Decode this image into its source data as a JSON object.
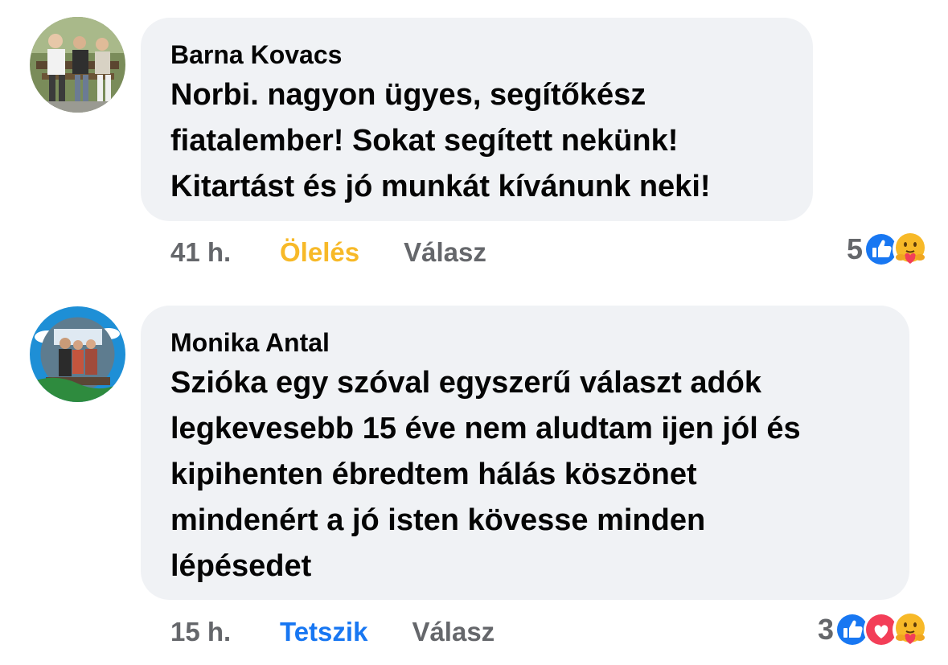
{
  "comments": [
    {
      "author": "Barna Kovacs",
      "text": "Norbi. nagyon ügyes, segítőkész fiatalember! Sokat segített nekünk! Kitartást és jó munkát kívánunk neki!",
      "lines": [
        "Norbi. nagyon ügyes, segítőkész",
        "fiatalember! Sokat segített nekünk!",
        "Kitartást és jó munkát kívánunk neki!"
      ],
      "time": "41 h.",
      "reaction_label": "Ölelés",
      "reaction_label_color": "#f7b928",
      "reply_label": "Válasz",
      "reaction_count": "5",
      "reaction_icons": [
        "like-icon",
        "care-icon"
      ]
    },
    {
      "author": "Monika Antal",
      "text": "Szióka egy szóval egyszerű választ adók legkevesebb 15 éve nem aludtam ijen jól és kipihenten ébredtem hálás köszönet mindenért a jó isten kövesse minden lépésedet",
      "lines": [
        "Szióka egy szóval egyszerű választ adók",
        "legkevesebb 15 éve nem aludtam ijen jól és",
        "kipihenten ébredtem hálás köszönet",
        "mindenért a jó isten kövesse minden",
        "lépésedet"
      ],
      "time": "15 h.",
      "reaction_label": "Tetszik",
      "reaction_label_color": "#1877f2",
      "reply_label": "Válasz",
      "reaction_count": "3",
      "reaction_icons": [
        "like-icon",
        "love-icon",
        "care-icon"
      ]
    }
  ],
  "colors": {
    "bubble": "#f0f2f5",
    "secondary_text": "#65676b",
    "like_blue": "#1877f2",
    "love_red": "#f33e58",
    "care_yellow": "#f7b928"
  }
}
